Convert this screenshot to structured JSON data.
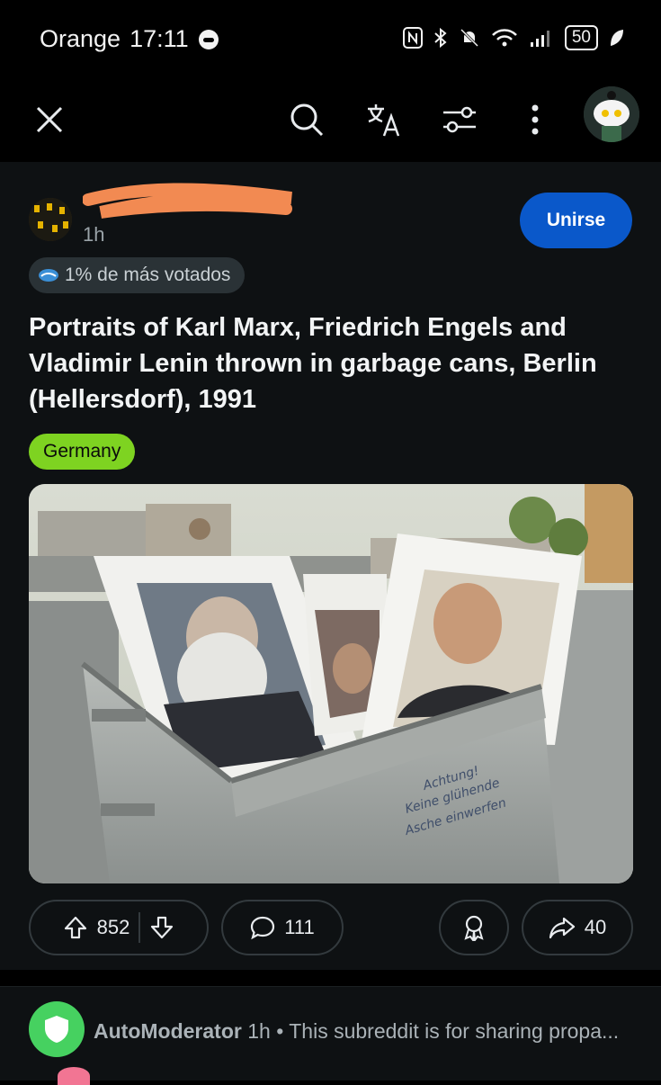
{
  "status": {
    "carrier": "Orange",
    "time": "17:11",
    "battery": "50"
  },
  "nav": {
    "icons": [
      "close-icon",
      "search-icon",
      "translate-icon",
      "filter-icon",
      "more-icon",
      "user-avatar"
    ]
  },
  "post": {
    "meta": "1h",
    "join_label": "Unirse",
    "badge": "1% de más votados",
    "title": "Portraits of Karl Marx, Friedrich Engels and Vladimir Lenin thrown in garbage cans, Berlin (Hellersdorf), 1991",
    "flair": "Germany",
    "flair_color": "#7ed321",
    "image_text": [
      "Achtung!",
      "Keine glühende",
      "Asche einwerfen"
    ],
    "upvotes": "852",
    "comments": "111",
    "shares": "40"
  },
  "comment": {
    "author": "AutoModerator",
    "time": "1h",
    "separator": "•",
    "text": "This subreddit is for sharing propa..."
  },
  "colors": {
    "accent": "#0a58ca",
    "background": "#0e1113",
    "mod_green": "#46d160"
  }
}
